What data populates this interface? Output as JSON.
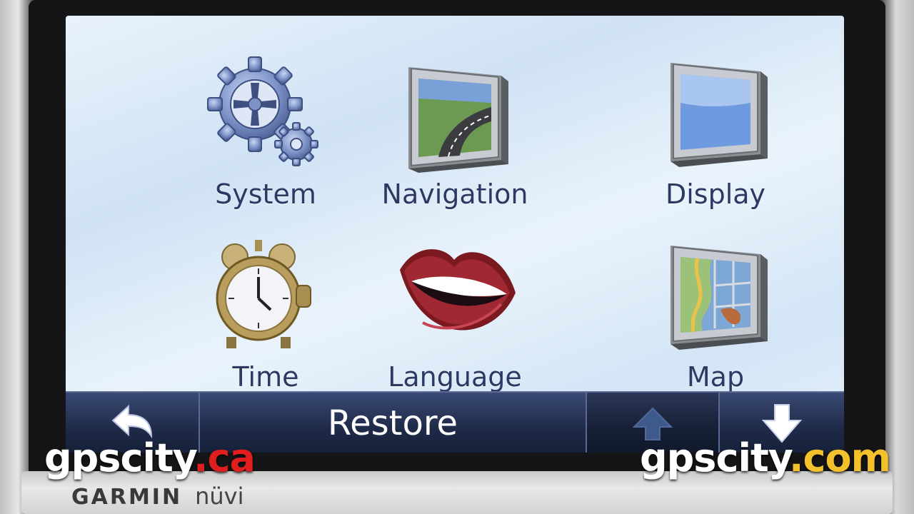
{
  "device": {
    "maker": "GARMIN",
    "model": "nüvi"
  },
  "menu": {
    "tiles": [
      {
        "label": "System",
        "icon": "gears-icon"
      },
      {
        "label": "Navigation",
        "icon": "road-screen-icon"
      },
      {
        "label": "Display",
        "icon": "monitor-icon"
      },
      {
        "label": "Time",
        "icon": "alarm-clock-icon"
      },
      {
        "label": "Language",
        "icon": "lips-icon"
      },
      {
        "label": "Map",
        "icon": "map-screen-icon"
      }
    ]
  },
  "toolbar": {
    "back_icon": "back-arrow-icon",
    "restore_label": "Restore",
    "up_icon": "arrow-up-icon",
    "down_icon": "arrow-down-icon"
  },
  "watermarks": {
    "left": {
      "base": "gpscity",
      "suffix": ".ca"
    },
    "right": {
      "base": "gpscity",
      "suffix": ".com"
    }
  },
  "colors": {
    "label": "#2c3a63",
    "toolbar": "#1f2a48",
    "watermark_ca": "#e01e1e",
    "watermark_com": "#f2c12b"
  }
}
